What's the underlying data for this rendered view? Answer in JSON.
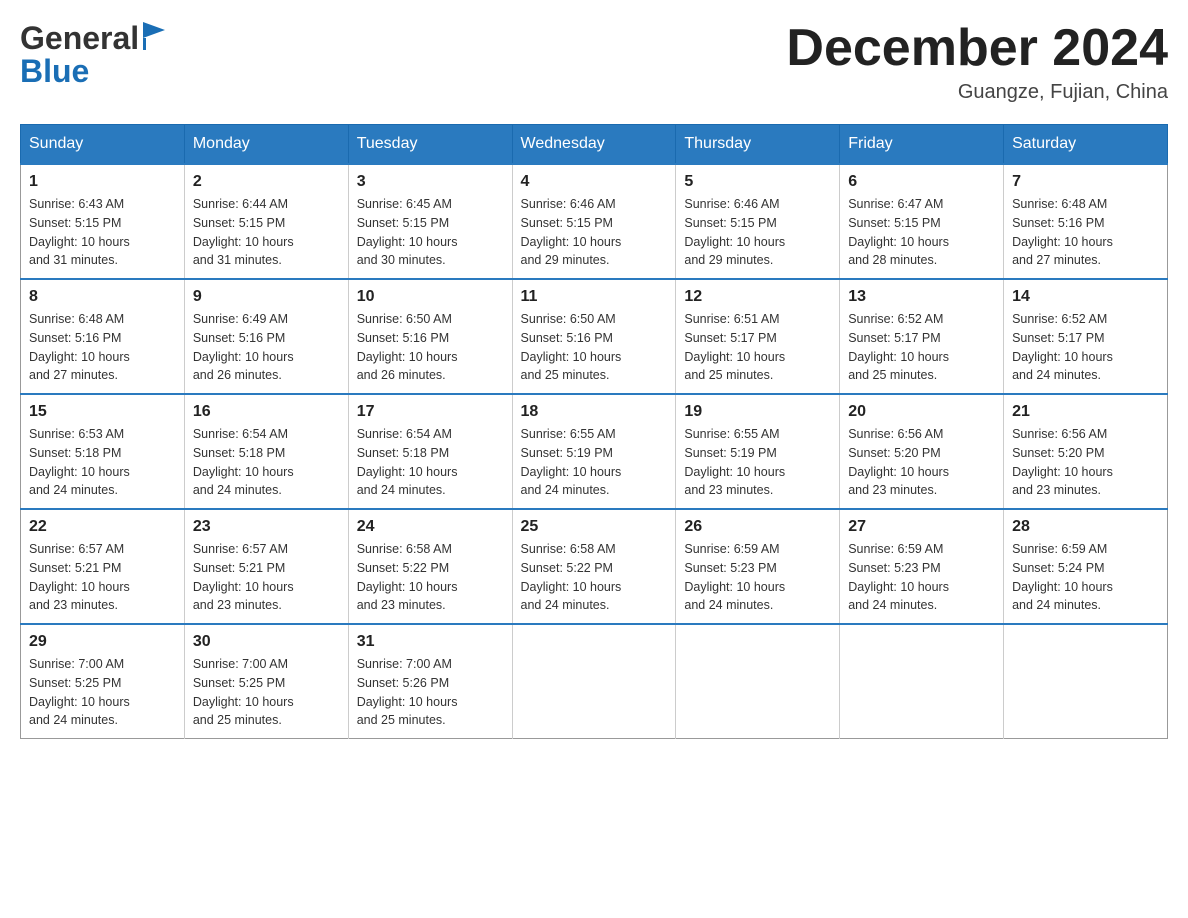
{
  "header": {
    "logo_general": "General",
    "logo_blue": "Blue",
    "month_title": "December 2024",
    "location": "Guangze, Fujian, China"
  },
  "days_header": [
    "Sunday",
    "Monday",
    "Tuesday",
    "Wednesday",
    "Thursday",
    "Friday",
    "Saturday"
  ],
  "weeks": [
    [
      {
        "day": "1",
        "sunrise": "6:43 AM",
        "sunset": "5:15 PM",
        "daylight": "10 hours and 31 minutes."
      },
      {
        "day": "2",
        "sunrise": "6:44 AM",
        "sunset": "5:15 PM",
        "daylight": "10 hours and 31 minutes."
      },
      {
        "day": "3",
        "sunrise": "6:45 AM",
        "sunset": "5:15 PM",
        "daylight": "10 hours and 30 minutes."
      },
      {
        "day": "4",
        "sunrise": "6:46 AM",
        "sunset": "5:15 PM",
        "daylight": "10 hours and 29 minutes."
      },
      {
        "day": "5",
        "sunrise": "6:46 AM",
        "sunset": "5:15 PM",
        "daylight": "10 hours and 29 minutes."
      },
      {
        "day": "6",
        "sunrise": "6:47 AM",
        "sunset": "5:15 PM",
        "daylight": "10 hours and 28 minutes."
      },
      {
        "day": "7",
        "sunrise": "6:48 AM",
        "sunset": "5:16 PM",
        "daylight": "10 hours and 27 minutes."
      }
    ],
    [
      {
        "day": "8",
        "sunrise": "6:48 AM",
        "sunset": "5:16 PM",
        "daylight": "10 hours and 27 minutes."
      },
      {
        "day": "9",
        "sunrise": "6:49 AM",
        "sunset": "5:16 PM",
        "daylight": "10 hours and 26 minutes."
      },
      {
        "day": "10",
        "sunrise": "6:50 AM",
        "sunset": "5:16 PM",
        "daylight": "10 hours and 26 minutes."
      },
      {
        "day": "11",
        "sunrise": "6:50 AM",
        "sunset": "5:16 PM",
        "daylight": "10 hours and 25 minutes."
      },
      {
        "day": "12",
        "sunrise": "6:51 AM",
        "sunset": "5:17 PM",
        "daylight": "10 hours and 25 minutes."
      },
      {
        "day": "13",
        "sunrise": "6:52 AM",
        "sunset": "5:17 PM",
        "daylight": "10 hours and 25 minutes."
      },
      {
        "day": "14",
        "sunrise": "6:52 AM",
        "sunset": "5:17 PM",
        "daylight": "10 hours and 24 minutes."
      }
    ],
    [
      {
        "day": "15",
        "sunrise": "6:53 AM",
        "sunset": "5:18 PM",
        "daylight": "10 hours and 24 minutes."
      },
      {
        "day": "16",
        "sunrise": "6:54 AM",
        "sunset": "5:18 PM",
        "daylight": "10 hours and 24 minutes."
      },
      {
        "day": "17",
        "sunrise": "6:54 AM",
        "sunset": "5:18 PM",
        "daylight": "10 hours and 24 minutes."
      },
      {
        "day": "18",
        "sunrise": "6:55 AM",
        "sunset": "5:19 PM",
        "daylight": "10 hours and 24 minutes."
      },
      {
        "day": "19",
        "sunrise": "6:55 AM",
        "sunset": "5:19 PM",
        "daylight": "10 hours and 23 minutes."
      },
      {
        "day": "20",
        "sunrise": "6:56 AM",
        "sunset": "5:20 PM",
        "daylight": "10 hours and 23 minutes."
      },
      {
        "day": "21",
        "sunrise": "6:56 AM",
        "sunset": "5:20 PM",
        "daylight": "10 hours and 23 minutes."
      }
    ],
    [
      {
        "day": "22",
        "sunrise": "6:57 AM",
        "sunset": "5:21 PM",
        "daylight": "10 hours and 23 minutes."
      },
      {
        "day": "23",
        "sunrise": "6:57 AM",
        "sunset": "5:21 PM",
        "daylight": "10 hours and 23 minutes."
      },
      {
        "day": "24",
        "sunrise": "6:58 AM",
        "sunset": "5:22 PM",
        "daylight": "10 hours and 23 minutes."
      },
      {
        "day": "25",
        "sunrise": "6:58 AM",
        "sunset": "5:22 PM",
        "daylight": "10 hours and 24 minutes."
      },
      {
        "day": "26",
        "sunrise": "6:59 AM",
        "sunset": "5:23 PM",
        "daylight": "10 hours and 24 minutes."
      },
      {
        "day": "27",
        "sunrise": "6:59 AM",
        "sunset": "5:23 PM",
        "daylight": "10 hours and 24 minutes."
      },
      {
        "day": "28",
        "sunrise": "6:59 AM",
        "sunset": "5:24 PM",
        "daylight": "10 hours and 24 minutes."
      }
    ],
    [
      {
        "day": "29",
        "sunrise": "7:00 AM",
        "sunset": "5:25 PM",
        "daylight": "10 hours and 24 minutes."
      },
      {
        "day": "30",
        "sunrise": "7:00 AM",
        "sunset": "5:25 PM",
        "daylight": "10 hours and 25 minutes."
      },
      {
        "day": "31",
        "sunrise": "7:00 AM",
        "sunset": "5:26 PM",
        "daylight": "10 hours and 25 minutes."
      },
      null,
      null,
      null,
      null
    ]
  ],
  "labels": {
    "sunrise": "Sunrise:",
    "sunset": "Sunset:",
    "daylight": "Daylight:"
  }
}
